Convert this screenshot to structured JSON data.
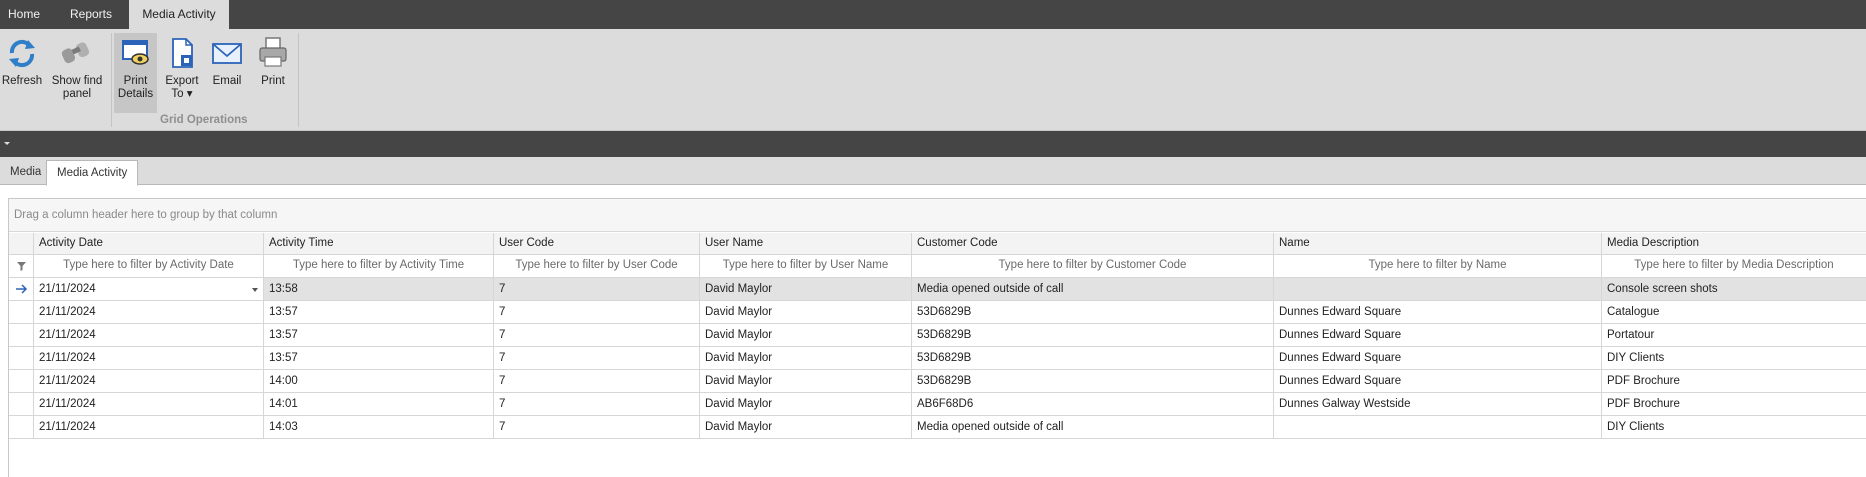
{
  "top_tabs": [
    {
      "label": "Home"
    },
    {
      "label": "Reports"
    },
    {
      "label": "Media  Activity"
    }
  ],
  "ribbon": {
    "refresh": "Refresh",
    "show_find_line1": "Show find",
    "show_find_line2": "panel",
    "print_details_line1": "Print",
    "print_details_line2": "Details",
    "export_line1": "Export",
    "export_line2": "To",
    "email": "Email",
    "print": "Print",
    "group_label": "Grid Operations"
  },
  "doc_tabs": [
    {
      "label": "Media"
    },
    {
      "label": "Media  Activity"
    }
  ],
  "grid": {
    "group_panel_text": "Drag a column header here to group by that column",
    "columns": [
      {
        "header": "Activity Date",
        "filter": "Type here to filter by Activity Date"
      },
      {
        "header": "Activity Time",
        "filter": "Type here to filter by Activity Time"
      },
      {
        "header": "User Code",
        "filter": "Type here to filter by User Code"
      },
      {
        "header": "User Name",
        "filter": "Type here to filter by User Name"
      },
      {
        "header": "Customer Code",
        "filter": "Type here to filter by Customer Code"
      },
      {
        "header": "Name",
        "filter": "Type here to filter by Name"
      },
      {
        "header": "Media Description",
        "filter": "Type here to filter by Media Description"
      }
    ],
    "rows": [
      [
        "21/11/2024",
        "13:58",
        "7",
        "David Maylor",
        "Media opened outside of call",
        "",
        "Console screen  shots"
      ],
      [
        "21/11/2024",
        "13:57",
        "7",
        "David Maylor",
        "53D6829B",
        "Dunnes Edward Square",
        "Catalogue"
      ],
      [
        "21/11/2024",
        "13:57",
        "7",
        "David Maylor",
        "53D6829B",
        "Dunnes Edward Square",
        "Portatour"
      ],
      [
        "21/11/2024",
        "13:57",
        "7",
        "David Maylor",
        "53D6829B",
        "Dunnes Edward Square",
        "DIY Clients"
      ],
      [
        "21/11/2024",
        "14:00",
        "7",
        "David Maylor",
        "53D6829B",
        "Dunnes Edward Square",
        "PDF Brochure"
      ],
      [
        "21/11/2024",
        "14:01",
        "7",
        "David Maylor",
        "AB6F68D6",
        "Dunnes Galway Westside",
        "PDF Brochure"
      ],
      [
        "21/11/2024",
        "14:03",
        "7",
        "David Maylor",
        "Media opened outside of call",
        "",
        "DIY Clients"
      ]
    ]
  }
}
